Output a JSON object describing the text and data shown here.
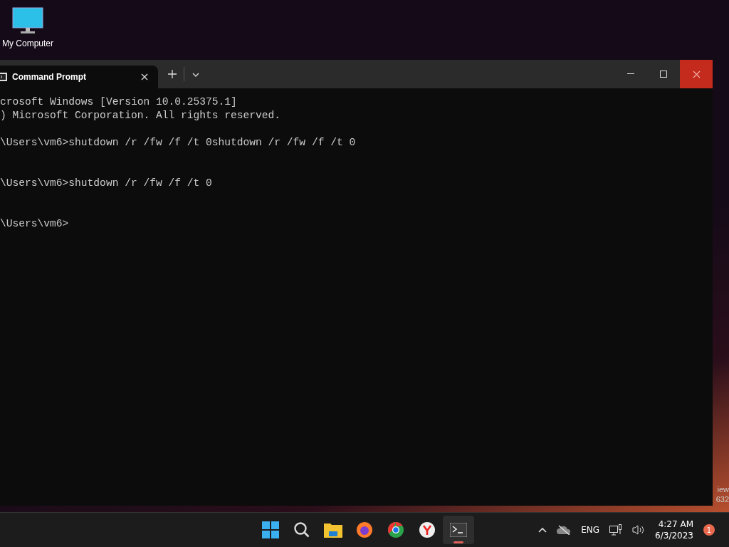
{
  "desktop": {
    "icons": [
      {
        "label": "My Computer"
      }
    ],
    "edge_text": [
      "iew",
      "632"
    ]
  },
  "window": {
    "tabs": [
      {
        "title": "Command Prompt",
        "selected": true
      }
    ],
    "blocks": [
      {
        "lines": [
          "crosoft Windows [Version 10.0.25375.1]",
          ") Microsoft Corporation. All rights reserved."
        ]
      },
      {
        "lines": [
          "\\Users\\vm6>shutdown /r /fw /f /t 0shutdown /r /fw /f /t 0"
        ]
      },
      {
        "lines": [
          "\\Users\\vm6>shutdown /r /fw /f /t 0"
        ]
      },
      {
        "lines": [
          "\\Users\\vm6>"
        ]
      }
    ]
  },
  "taskbar": {
    "apps": [
      {
        "kind": "start"
      },
      {
        "kind": "search"
      },
      {
        "kind": "files"
      },
      {
        "kind": "firefox"
      },
      {
        "kind": "chrome"
      },
      {
        "kind": "yandex"
      },
      {
        "kind": "terminal",
        "selected": true
      }
    ],
    "tray": {
      "language": "ENG",
      "time": "4:27 AM",
      "date": "6/3/2023",
      "notifications": "1"
    }
  }
}
